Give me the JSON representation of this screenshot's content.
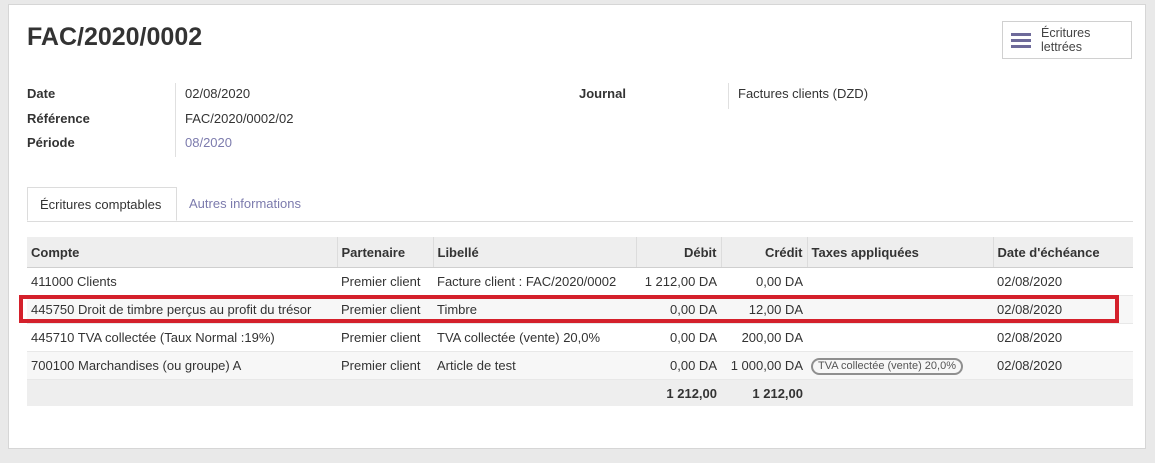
{
  "record": {
    "title": "FAC/2020/0002",
    "stat_button": {
      "label": "Écritures lettrées",
      "icon": "list-icon"
    }
  },
  "fields": {
    "date": {
      "label": "Date",
      "value": "02/08/2020"
    },
    "reference": {
      "label": "Référence",
      "value": "FAC/2020/0002/02"
    },
    "period": {
      "label": "Période",
      "value": "08/2020"
    },
    "journal": {
      "label": "Journal",
      "value": "Factures clients (DZD)"
    }
  },
  "tabs": [
    {
      "label": "Écritures comptables",
      "active": true
    },
    {
      "label": "Autres informations",
      "active": false
    }
  ],
  "table": {
    "columns": [
      "Compte",
      "Partenaire",
      "Libellé",
      "Débit",
      "Crédit",
      "Taxes appliquées",
      "Date d'échéance"
    ],
    "rows": [
      {
        "account": "411000 Clients",
        "partner": "Premier client",
        "label": "Facture client : FAC/2020/0002",
        "debit": "1 212,00 DA",
        "credit": "0,00 DA",
        "taxes": "",
        "due": "02/08/2020"
      },
      {
        "account": "445750 Droit de timbre perçus au profit du trésor",
        "partner": "Premier client",
        "label": "Timbre",
        "debit": "0,00 DA",
        "credit": "12,00 DA",
        "taxes": "",
        "due": "02/08/2020"
      },
      {
        "account": "445710 TVA collectée (Taux Normal :19%)",
        "partner": "Premier client",
        "label": "TVA collectée (vente) 20,0%",
        "debit": "0,00 DA",
        "credit": "200,00 DA",
        "taxes": "",
        "due": "02/08/2020"
      },
      {
        "account": "700100 Marchandises (ou groupe) A",
        "partner": "Premier client",
        "label": "Article de test",
        "debit": "0,00 DA",
        "credit": "1 000,00 DA",
        "taxes": "TVA collectée (vente) 20,0%",
        "due": "02/08/2020"
      }
    ],
    "totals": {
      "debit": "1 212,00",
      "credit": "1 212,00"
    }
  },
  "colors": {
    "link": "#7c7bad",
    "highlight": "#d4202b",
    "header_bg": "#eeeeee"
  }
}
